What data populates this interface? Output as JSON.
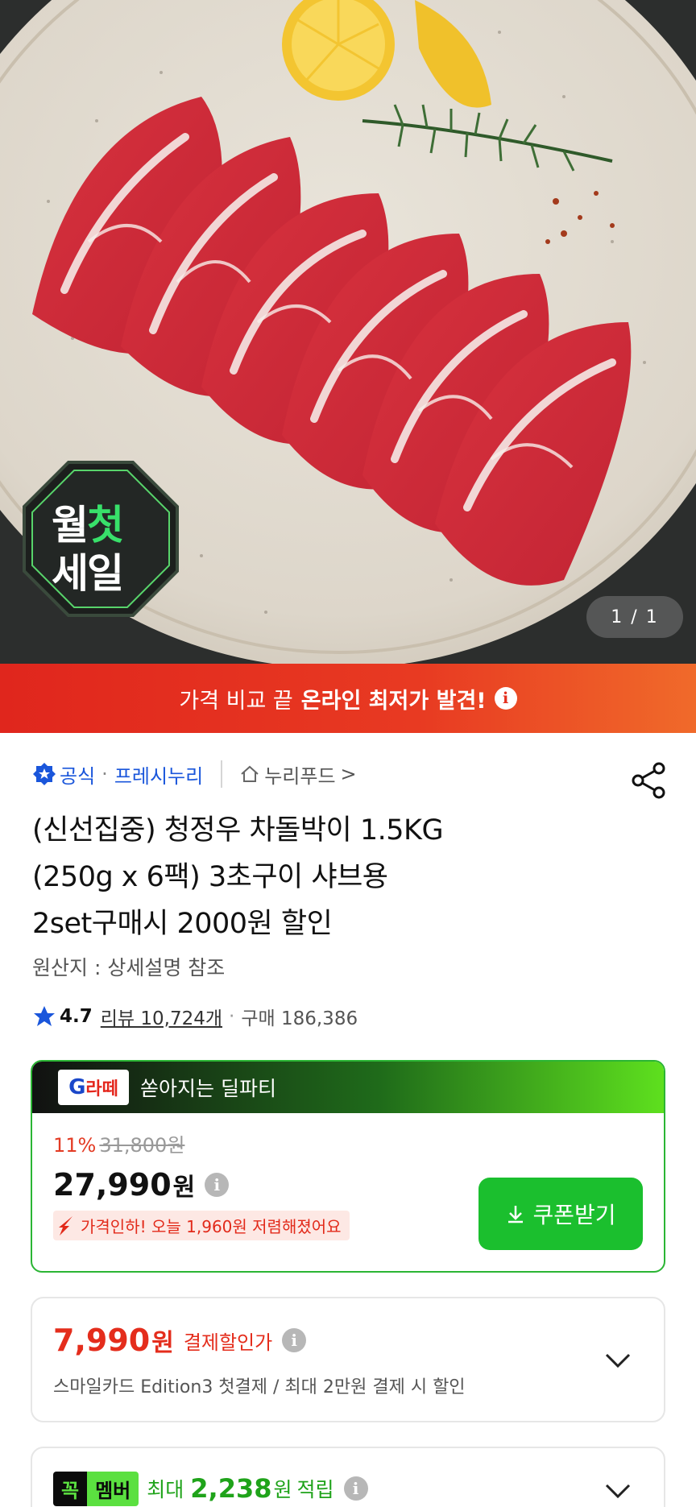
{
  "hero": {
    "counter": "1 / 1",
    "badge_line1_a": "월",
    "badge_line1_b": "첫",
    "badge_line2": "세일"
  },
  "banner": {
    "text_normal": "가격 비교 끝",
    "text_bold": "온라인 최저가 발견!",
    "info_icon": "info-icon"
  },
  "store": {
    "official_label": "공식",
    "separator": "·",
    "store_name": "프레시누리",
    "shop_name": "누리푸드",
    "shop_chevron": ">"
  },
  "product": {
    "title_line1": "(신선집중) 청정우 차돌박이 1.5KG",
    "title_line2": "(250g x 6팩) 3초구이 샤브용",
    "title_line3": "2set구매시 2000원 할인",
    "origin": "원산지 : 상세설명 참조",
    "rating": "4.7",
    "review_label": "리뷰 10,724개",
    "dot": "·",
    "purchase_label": "구매 186,386"
  },
  "deal": {
    "logo_text": "G",
    "logo_accent": "라떼",
    "title": "쏟아지는 딜파티",
    "discount": "11%",
    "original_price": "31,800원",
    "price": "27,990",
    "won": "원",
    "drop_text": "가격인하! 오늘 1,960원 저렴해졌어요",
    "coupon_button": "쿠폰받기"
  },
  "payment_option": {
    "price": "7,990",
    "won": "원",
    "label": "결제할인가",
    "desc": "스마일카드 Edition3 첫결제 / 최대 2만원 결제 시 할인"
  },
  "club_option": {
    "badge_k": "꼭",
    "badge_m": "멤버",
    "prefix": "최대",
    "amount": "2,238",
    "won": "원",
    "suffix": "적립"
  },
  "colors": {
    "banner_red": "#e0261d",
    "link_blue": "#1a56db",
    "sale_red": "#e42d1c",
    "deal_green": "#1bbf2e",
    "club_green": "#5be040"
  }
}
